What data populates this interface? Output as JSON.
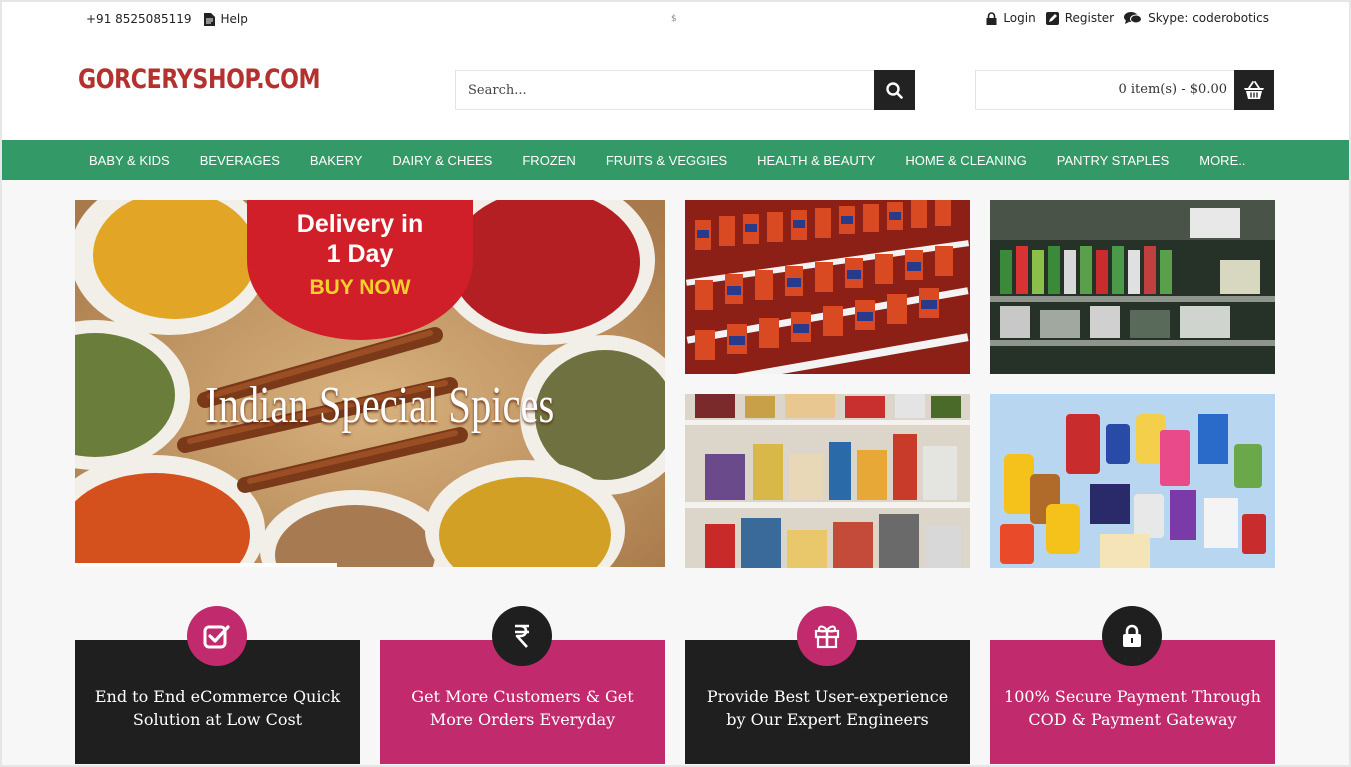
{
  "topbar": {
    "phone": "+91 8525085119",
    "help": "Help",
    "currency": "$",
    "login": "Login",
    "register": "Register",
    "skype": "Skype: coderobotics"
  },
  "header": {
    "logo": "GORCERYSHOP.COM",
    "search_placeholder": "Search...",
    "cart_text": "0 item(s) - $0.00"
  },
  "nav": {
    "items": [
      "BABY & KIDS",
      "BEVERAGES",
      "BAKERY",
      "DAIRY & CHEES",
      "FROZEN",
      "FRUITS & VEGGIES",
      "HEALTH & BEAUTY",
      "HOME & CLEANING",
      "PANTRY STAPLES",
      "MORE.."
    ]
  },
  "banner": {
    "delivery_line1": "Delivery in",
    "delivery_line2": "1 Day",
    "buy_now": "BUY NOW",
    "title": "Indian Special Spices"
  },
  "features": [
    {
      "text": "End to End eCommerce Quick Solution at Low Cost",
      "icon": "check-square-icon"
    },
    {
      "text": "Get More Customers & Get More Orders Everyday",
      "icon": "rupee-icon"
    },
    {
      "text": "Provide Best User-experience by Our Expert Engineers",
      "icon": "gift-icon"
    },
    {
      "text": "100% Secure Payment Through COD & Payment Gateway",
      "icon": "lock-icon"
    }
  ],
  "colors": {
    "nav_green": "#339966",
    "logo_red": "#b3312e",
    "pink": "#c12a6c",
    "dark": "#1f1f1f"
  }
}
